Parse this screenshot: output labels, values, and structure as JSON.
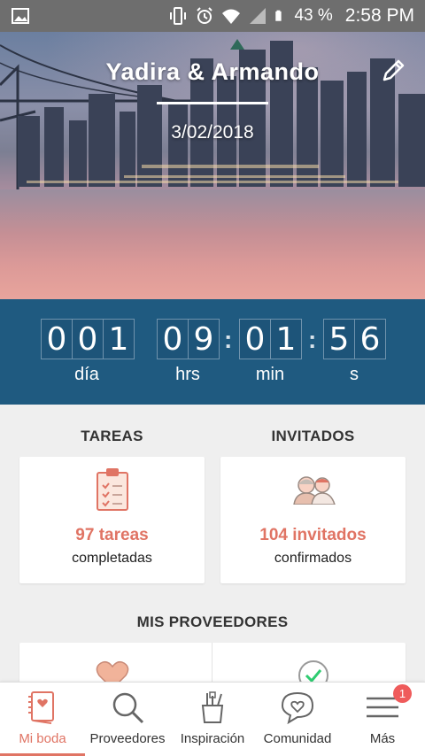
{
  "status_bar": {
    "battery": "43 %",
    "time": "2:58 PM"
  },
  "header": {
    "couple": "Yadira & Armando",
    "date": "3/02/2018"
  },
  "countdown": {
    "days": [
      "0",
      "0",
      "1"
    ],
    "hours": [
      "0",
      "9"
    ],
    "minutes": [
      "0",
      "1"
    ],
    "seconds": [
      "5",
      "6"
    ],
    "separator": ":",
    "labels": {
      "days": "día",
      "hours": "hrs",
      "minutes": "min",
      "seconds": "s"
    }
  },
  "tareas": {
    "title": "TAREAS",
    "count": "97 tareas",
    "caption": "completadas"
  },
  "invitados": {
    "title": "INVITADOS",
    "count": "104 invitados",
    "caption": "confirmados"
  },
  "proveedores": {
    "title": "MIS PROVEEDORES"
  },
  "bottom_nav": {
    "items": [
      {
        "label": "Mi boda",
        "icon": "wedding-book-icon"
      },
      {
        "label": "Proveedores",
        "icon": "search-icon"
      },
      {
        "label": "Inspiración",
        "icon": "inspiration-tools-icon"
      },
      {
        "label": "Comunidad",
        "icon": "chat-heart-icon"
      },
      {
        "label": "Más",
        "icon": "menu-icon"
      }
    ],
    "badge": "1"
  },
  "colors": {
    "accent": "#e07464",
    "countdown_bg": "#1f5a80",
    "status_bar": "#6e6e6e"
  }
}
